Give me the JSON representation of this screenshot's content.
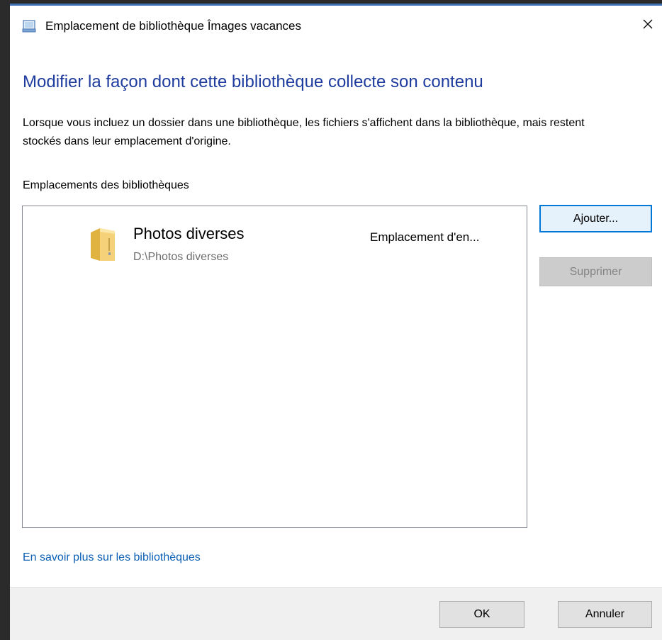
{
  "window": {
    "title": "Emplacement de bibliothèque Îmages vacances",
    "icon": "library-icon",
    "close_icon": "close-icon"
  },
  "main": {
    "heading": "Modifier la façon dont cette bibliothèque collecte son contenu",
    "description": "Lorsque vous incluez un dossier dans une bibliothèque, les fichiers s'affichent dans la bibliothèque, mais restent stockés dans leur emplacement d'origine.",
    "list_label": "Emplacements des bibliothèques",
    "locations": [
      {
        "name": "Photos diverses",
        "path": "D:\\Photos diverses",
        "status": "Emplacement d'en...",
        "icon": "folder-icon"
      }
    ]
  },
  "buttons": {
    "add": "Ajouter...",
    "remove": "Supprimer",
    "ok": "OK",
    "cancel": "Annuler"
  },
  "link": {
    "learn_more": "En savoir plus sur les bibliothèques"
  },
  "colors": {
    "heading": "#1e3c9e",
    "link": "#0c5fb4",
    "focus_border": "#0078d7",
    "footer_bg": "#f0f0f0"
  }
}
